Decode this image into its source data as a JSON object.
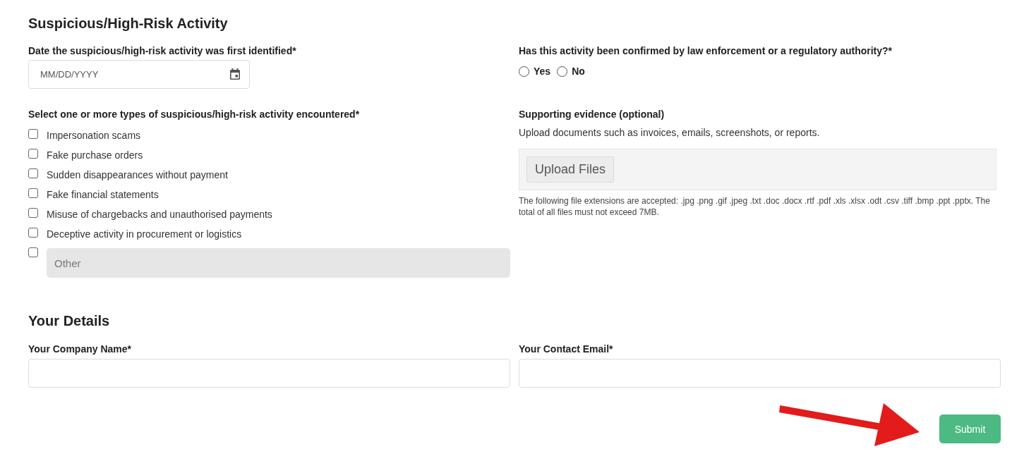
{
  "activity_section": {
    "title": "Suspicious/High-Risk Activity",
    "date_field": {
      "label": "Date the suspicious/high-risk activity was first identified*",
      "placeholder": "MM/DD/YYYY"
    },
    "confirmation": {
      "label": "Has this activity been confirmed by law enforcement or a regulatory authority?*",
      "options": [
        {
          "label": "Yes",
          "selected": false
        },
        {
          "label": "No",
          "selected": false
        }
      ]
    },
    "activity_types": {
      "label": "Select one or more types of suspicious/high-risk activity encountered*",
      "options": [
        {
          "label": "Impersonation scams",
          "checked": false
        },
        {
          "label": "Fake purchase orders",
          "checked": false
        },
        {
          "label": "Sudden disappearances without payment",
          "checked": false
        },
        {
          "label": "Fake financial statements",
          "checked": false
        },
        {
          "label": "Misuse of chargebacks and unauthorised payments",
          "checked": false
        },
        {
          "label": "Deceptive activity in procurement or logistics",
          "checked": false
        }
      ],
      "other": {
        "checked": false,
        "placeholder": "Other"
      }
    },
    "evidence": {
      "label": "Supporting evidence (optional)",
      "description": "Upload documents such as invoices, emails, screenshots, or reports.",
      "upload_button": "Upload Files",
      "note": "The following file extensions are accepted: .jpg .png .gif .jpeg .txt .doc .docx .rtf .pdf .xls .xlsx .odt .csv .tiff .bmp .ppt .pptx. The total of all files must not exceed 7MB."
    }
  },
  "details_section": {
    "title": "Your Details",
    "fields": [
      {
        "label": "Your Company Name*"
      },
      {
        "label": "Your Contact Email*"
      }
    ]
  },
  "submit_button": "Submit"
}
